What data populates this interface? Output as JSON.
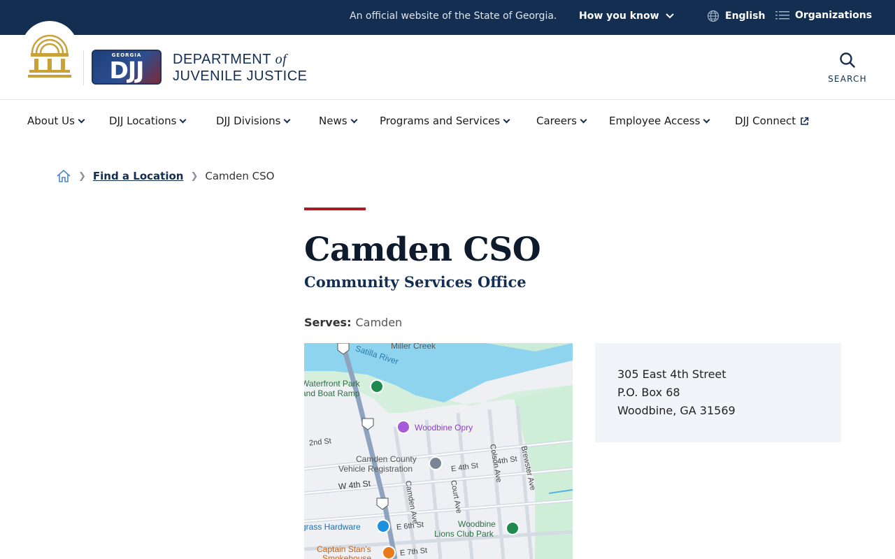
{
  "topbar": {
    "official_text": "An official website of the State of Georgia.",
    "how_you_know": "How you know",
    "language": "English",
    "organizations": "Organizations"
  },
  "header": {
    "logo_small_text": "GEORGIA",
    "logo_text": "DJJ",
    "dept_line1": "DEPARTMENT",
    "dept_of": "of",
    "dept_line2": "JUVENILE JUSTICE",
    "search_label": "SEARCH"
  },
  "nav": {
    "items": [
      {
        "label": "About Us"
      },
      {
        "label": "DJJ Locations"
      },
      {
        "label": "DJJ Divisions"
      },
      {
        "label": "News"
      },
      {
        "label": "Programs and Services"
      },
      {
        "label": "Careers"
      },
      {
        "label": "Employee Access"
      },
      {
        "label": "DJJ Connect"
      }
    ]
  },
  "breadcrumb": {
    "link": "Find a Location",
    "current": "Camden CSO"
  },
  "main": {
    "title": "Camden CSO",
    "subtitle": "Community Services Office",
    "serves_label": "Serves:",
    "serves_value": "Camden"
  },
  "map": {
    "labels": {
      "miller_creek": "Miller Creek",
      "satilla_river": "Satilla River",
      "waterfront1": "Waterfront Park",
      "waterfront2": "and Boat Ramp",
      "opry": "Woodbine Opry",
      "second_st": "2nd St",
      "vehicle1": "Camden County",
      "vehicle2": "Vehicle Registration",
      "e4th": "E 4th St",
      "fourth_st": "4th St",
      "colson": "Colson Ave",
      "brewster": "Brewster Ave",
      "w4th": "W 4th St",
      "court": "Court Ave",
      "camden_ave": "Camden Ave",
      "hardware": "grass Hardware",
      "e6th": "E 6th St",
      "lions1": "Woodbine",
      "lions2": "Lions Club Park",
      "captain1": "Captain Stan's",
      "captain2": "Smokehouse",
      "e7th": "E 7th St",
      "route": "17"
    }
  },
  "address": {
    "line1": "305 East 4th Street",
    "line2": "P.O. Box 68",
    "line3": "Woodbine, GA 31569"
  },
  "colors": {
    "topbar": "#132e51",
    "accent_red": "#a51d22",
    "seal_gold": "#c9a13b"
  }
}
